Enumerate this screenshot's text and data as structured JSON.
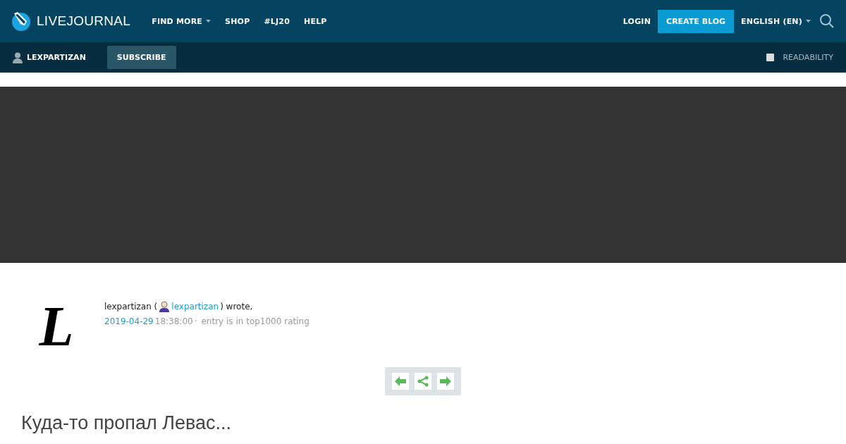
{
  "header": {
    "logo": "LIVEJOURNAL",
    "nav": [
      {
        "label": "FIND MORE",
        "dropdown": true
      },
      {
        "label": "SHOP",
        "dropdown": false
      },
      {
        "label": "#LJ20",
        "dropdown": false
      },
      {
        "label": "HELP",
        "dropdown": false
      }
    ],
    "login": "LOGIN",
    "create": "CREATE BLOG",
    "language": "ENGLISH (EN)"
  },
  "subbar": {
    "user": "LEXPARTIZAN",
    "subscribe": "SUBSCRIBE",
    "readability": {
      "label": "READABILITY",
      "checked": false
    }
  },
  "post": {
    "userpic": "L",
    "author": "lexpartizan (",
    "author_link": "lexpartizan",
    "wrote": ") wrote,",
    "date": "2019-04-29",
    "time": "18:38:00",
    "separator": "·",
    "rating": "entry is in top1000 rating",
    "title": "Куда-то пропал Левас..."
  }
}
